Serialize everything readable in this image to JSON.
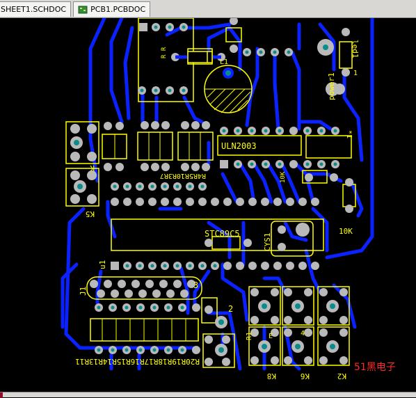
{
  "tabs": [
    {
      "label": "SHEET1.SCHDOC",
      "active": false
    },
    {
      "label": "PCB1.PCBDOC",
      "active": true
    }
  ],
  "board_labels": {
    "chip_uln": "ULN2003",
    "chip_stc": "STC89C5",
    "crystal": "CYS1",
    "resistor_10k": "10K",
    "res_bank": "R4R5R10R3R7",
    "power": "power1",
    "led": "led1",
    "res_row": "R20R19R18R17R16R15R14R13R11",
    "k8": "K8",
    "k6": "K6",
    "k2": "K2",
    "k5": "K5",
    "u1": "u1",
    "j1": "J1",
    "h1": "*1",
    "n2": "2",
    "n3": "3",
    "n4": "4",
    "n1": "1",
    "l1": "L1",
    "r1": "R1",
    "k": "K",
    "e": "E",
    "rr": "R R"
  },
  "watermark": "51黑电子",
  "colors": {
    "trace": "#0a22ff",
    "silk": "#ffff00",
    "pad": "#b9b9b9",
    "via": "#0a8c8c",
    "background": "#000000"
  }
}
